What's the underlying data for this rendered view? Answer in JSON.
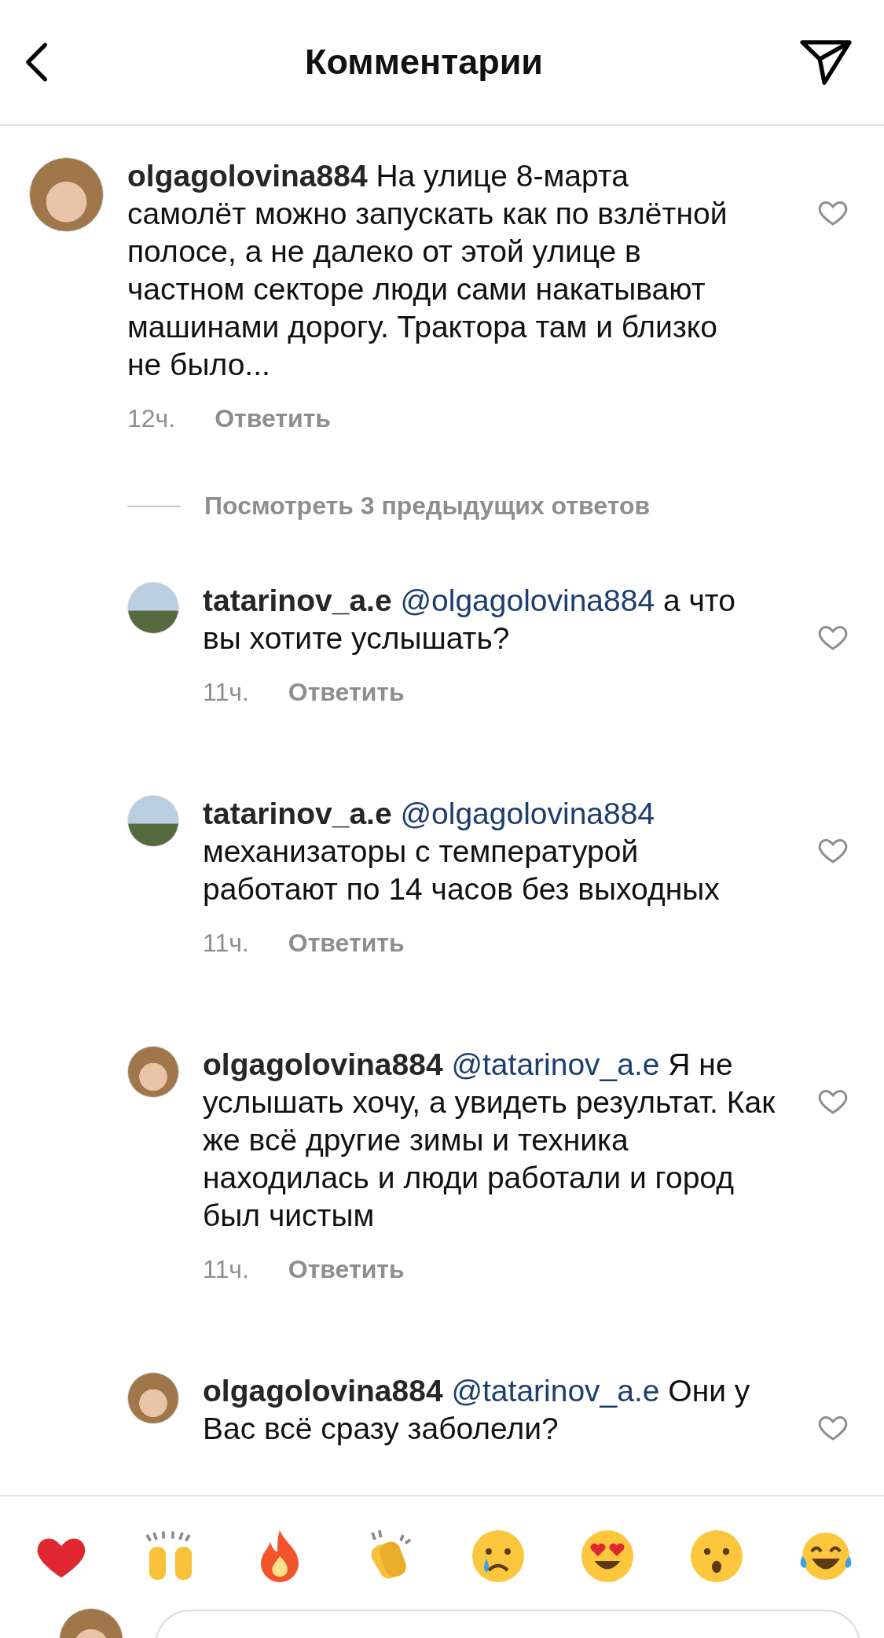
{
  "header": {
    "title": "Комментарии"
  },
  "comment": {
    "username": "olgagolovina884",
    "text": "На улице 8-марта самолёт можно запускать как по взлётной полосе, а не далеко от этой улице в частном секторе люди сами накатывают машинами дорогу. Трактора там и близко не было...",
    "time": "12ч.",
    "reply_label": "Ответить",
    "liked": false
  },
  "view_replies": "Посмотреть 3 предыдущих ответов",
  "replies": [
    {
      "username": "tatarinov_a.e",
      "mention": "@olgagolovina884",
      "text": "а что вы хотите  услышать?",
      "time": "11ч.",
      "reply_label": "Ответить",
      "liked": false
    },
    {
      "username": "tatarinov_a.e",
      "mention": "@olgagolovina884",
      "text": "механизаторы с температурой работают по 14 часов без выходных",
      "time": "11ч.",
      "reply_label": "Ответить",
      "liked": false
    },
    {
      "username": "olgagolovina884",
      "mention": "@tatarinov_a.e",
      "text": "Я не услышать хочу, а увидеть результат.  Как же всё другие зимы и техника находилась и люди работали и город был чистым",
      "time": "11ч.",
      "reply_label": "Ответить",
      "liked": false
    },
    {
      "username": "olgagolovina884",
      "mention": "@tatarinov_a.e",
      "text": "Они у Вас всё сразу заболели?",
      "liked": false
    }
  ]
}
